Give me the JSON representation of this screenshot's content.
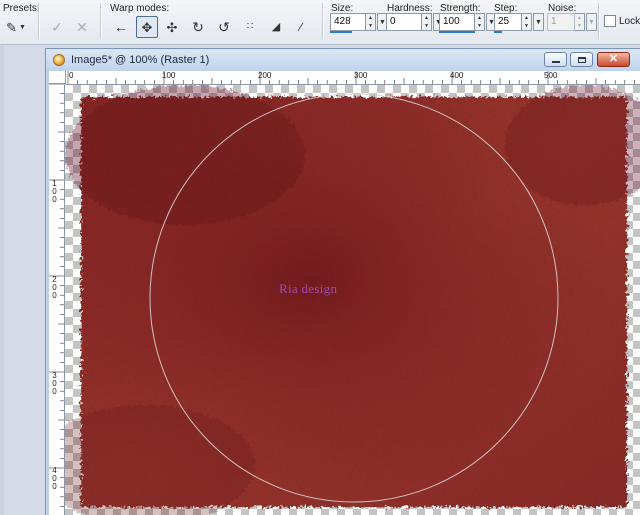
{
  "toolbar": {
    "presets_label": "Presets:",
    "warp_modes_label": "Warp modes:",
    "size_label": "Size:",
    "size_value": "428",
    "hardness_label": "Hardness:",
    "hardness_value": "0",
    "strength_label": "Strength:",
    "strength_value": "100",
    "step_label": "Step:",
    "step_value": "25",
    "noise_label": "Noise:",
    "noise_value": "1",
    "lock_label": "Lock",
    "icons": [
      "presets-brush-icon",
      "apply-check-icon",
      "cancel-x-icon",
      "push-arrow-icon",
      "expand-icon",
      "contract-icon",
      "twirl-right-icon",
      "twirl-left-icon",
      "noise-icon",
      "iron-out-icon",
      "unwarp-icon"
    ]
  },
  "window": {
    "title": "Image5* @ 100% (Raster 1)",
    "ruler_top": [
      "0",
      "100",
      "200",
      "300",
      "400",
      "500"
    ],
    "ruler_left": [
      {
        "digits": [
          "1",
          "0",
          "0"
        ]
      },
      {
        "digits": [
          "2",
          "0",
          "0"
        ]
      },
      {
        "digits": [
          "3",
          "0",
          "0"
        ]
      },
      {
        "digits": [
          "4",
          "0",
          "0"
        ]
      }
    ]
  },
  "canvas": {
    "watermark": "Ria design",
    "texture_color": "#9a2f2a",
    "shadow_color": "#6e1018"
  }
}
